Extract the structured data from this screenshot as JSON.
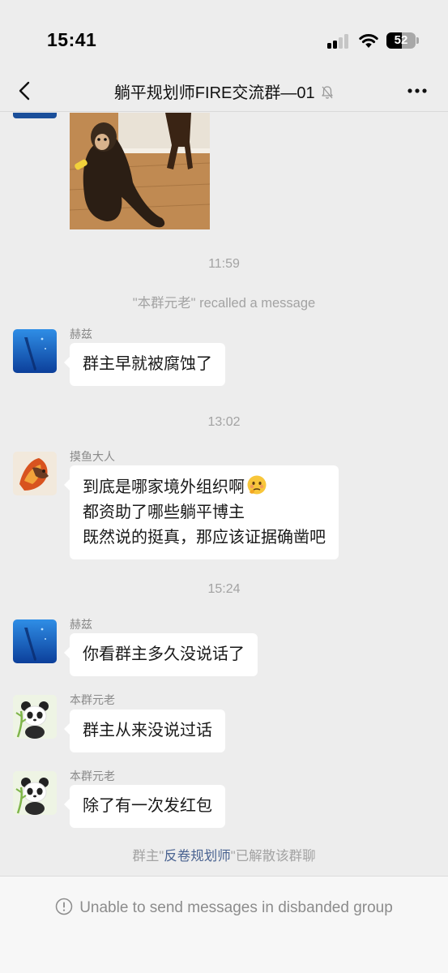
{
  "status_bar": {
    "time": "15:41",
    "battery": "52"
  },
  "header": {
    "title": "躺平规划师FIRE交流群—01"
  },
  "feed": {
    "time_1": "11:59",
    "recall_notice": "\"本群元老\" recalled a message",
    "msg_1": {
      "sender": "赫兹",
      "text": "群主早就被腐蚀了"
    },
    "time_2": "13:02",
    "msg_2": {
      "sender": "摸鱼大人",
      "line_1": "到底是哪家境外组织啊",
      "line_2": "都资助了哪些躺平博主",
      "line_3": "既然说的挺真，那应该证据确凿吧"
    },
    "time_3": "15:24",
    "msg_3": {
      "sender": "赫兹",
      "text": "你看群主多久没说话了"
    },
    "msg_4": {
      "sender": "本群元老",
      "text": "群主从来没说过话"
    },
    "msg_5": {
      "sender": "本群元老",
      "text": "除了有一次发红包"
    },
    "disband_notice": {
      "prefix": "群主\"",
      "owner": "反卷规划师",
      "suffix": "\"已解散该群聊"
    }
  },
  "footer": {
    "text": "Unable to send messages in disbanded group"
  },
  "colors": {
    "background": "#ededed",
    "bubble": "#ffffff",
    "link": "#4a6391",
    "muted_text": "#a3a3a3"
  },
  "icons": [
    "back-arrow-icon",
    "mute-bell-icon",
    "more-dots-icon",
    "info-circle-icon",
    "signal-icon",
    "wifi-icon",
    "battery-icon"
  ]
}
